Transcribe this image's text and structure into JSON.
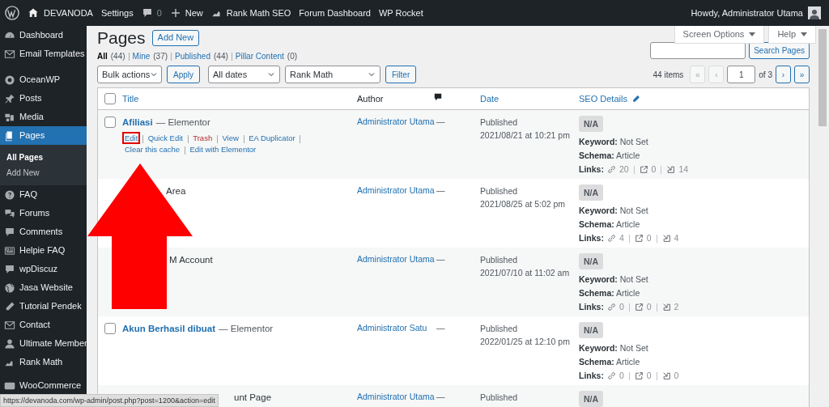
{
  "admin_bar": {
    "site": "DEVANODA",
    "items": [
      "Settings",
      "0",
      "New",
      "Rank Math SEO",
      "Forum Dashboard",
      "WP Rocket"
    ],
    "greeting": "Howdy, Administrator Utama"
  },
  "sidebar": {
    "groups": [
      [
        {
          "label": "Dashboard",
          "selected": false
        },
        {
          "label": "Email Templates",
          "selected": false
        }
      ],
      [
        {
          "label": "OceanWP",
          "selected": false
        },
        {
          "label": "Posts",
          "selected": false
        },
        {
          "label": "Media",
          "selected": false
        },
        {
          "label": "Pages",
          "selected": true,
          "children": [
            {
              "label": "All Pages",
              "selected": true
            },
            {
              "label": "Add New",
              "selected": false
            }
          ]
        },
        {
          "label": "FAQ",
          "selected": false
        },
        {
          "label": "Forums",
          "selected": false
        },
        {
          "label": "Comments",
          "selected": false
        },
        {
          "label": "Helpie FAQ",
          "selected": false
        },
        {
          "label": "wpDiscuz",
          "selected": false
        },
        {
          "label": "Jasa Website",
          "selected": false
        },
        {
          "label": "Tutorial Pendek",
          "selected": false
        },
        {
          "label": "Contact",
          "selected": false
        },
        {
          "label": "Ultimate Member",
          "selected": false
        },
        {
          "label": "Rank Math",
          "selected": false
        }
      ],
      [
        {
          "label": "WooCommerce",
          "selected": false
        }
      ]
    ]
  },
  "screen_tabs": [
    "Screen Options",
    "Help"
  ],
  "heading": {
    "title": "Pages",
    "add_new": "Add New"
  },
  "views": [
    {
      "label": "All",
      "count": "(44)",
      "selected": true
    },
    {
      "label": "Mine",
      "count": "(37)",
      "selected": false
    },
    {
      "label": "Published",
      "count": "(44)",
      "selected": false
    },
    {
      "label": "Pillar Content",
      "count": "(0)",
      "selected": false
    }
  ],
  "search": {
    "button": "Search Pages"
  },
  "filters": {
    "bulk": "Bulk actions",
    "apply": "Apply",
    "dates": "All dates",
    "rank_math": "Rank Math",
    "filter": "Filter"
  },
  "pagination": {
    "items": "44 items",
    "first": {
      "label": "«",
      "disabled": true
    },
    "prev": {
      "label": "‹",
      "disabled": true
    },
    "page": "1",
    "of": "of 3",
    "next": {
      "label": "›",
      "disabled": false
    },
    "last": {
      "label": "»",
      "disabled": false
    }
  },
  "table": {
    "columns": [
      "Title",
      "Author",
      "Date",
      "SEO Details"
    ],
    "all_checked": false,
    "rows": [
      {
        "title": "Afiliasi",
        "suffix": "— Elementor",
        "checked": false,
        "actions": [
          {
            "label": "Edit",
            "kind": "link",
            "highlighted": true
          },
          {
            "label": "Quick Edit",
            "kind": "link",
            "highlighted": false
          },
          {
            "label": "Trash",
            "kind": "danger",
            "highlighted": false
          },
          {
            "label": "View",
            "kind": "link",
            "highlighted": false
          },
          {
            "label": "EA Duplicator",
            "kind": "link",
            "highlighted": false
          },
          {
            "label": "Clear this cache",
            "kind": "link",
            "highlighted": false
          },
          {
            "label": "Edit with Elementor",
            "kind": "link",
            "highlighted": false
          }
        ],
        "author": "Administrator Utama",
        "comments": "—",
        "status": "Published",
        "date": "2021/08/21 at 10:21 pm",
        "score": "N/A",
        "keyword_label": "Keyword:",
        "keyword": "Not Set",
        "schema_label": "Schema:",
        "schema": "Article",
        "links_label": "Links:",
        "links": [
          "20",
          "0",
          "14"
        ]
      },
      {
        "title": "Area",
        "author": "Administrator Utama",
        "comments": "—",
        "status": "Published",
        "date": "2021/08/25 at 5:02 pm",
        "score": "N/A",
        "keyword_label": "Keyword:",
        "keyword": "Not Set",
        "schema_label": "Schema:",
        "schema": "Article",
        "links_label": "Links:",
        "links": [
          "4",
          "0",
          "4"
        ]
      },
      {
        "title": "M Account",
        "author": "Administrator Utama",
        "comments": "—",
        "status": "Published",
        "date": "2021/07/10 at 11:02 am",
        "score": "N/A",
        "keyword_label": "Keyword:",
        "keyword": "Not Set",
        "schema_label": "Schema:",
        "schema": "Article",
        "links_label": "Links:",
        "links": [
          "0",
          "0",
          "2"
        ]
      },
      {
        "title": "Akun Berhasil dibuat",
        "suffix": "— Elementor",
        "checked": false,
        "author": "Administrator Satu",
        "comments": "—",
        "status": "Published",
        "date": "2022/01/25 at 12:10 pm",
        "score": "N/A",
        "keyword_label": "Keyword:",
        "keyword": "Not Set",
        "schema_label": "Schema:",
        "schema": "Article",
        "links_label": "Links:",
        "links": [
          "0",
          "0",
          "0"
        ]
      },
      {
        "title": "unt Page",
        "author": "Administrator Utama",
        "comments": "—",
        "status": "Published",
        "score": "N/A"
      }
    ]
  },
  "status_url": "https://devanoda.com/wp-admin/post.php?post=1200&action=edit"
}
